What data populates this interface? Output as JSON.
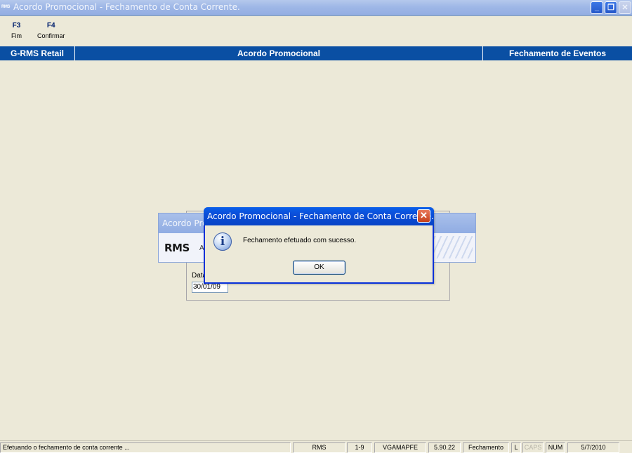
{
  "window": {
    "title": "Acordo Promocional - Fechamento de Conta Corrente.",
    "icon_label": "RMS"
  },
  "toolbar": {
    "keys": [
      {
        "key": "F3",
        "label": "Fim"
      },
      {
        "key": "F4",
        "label": "Confirmar"
      }
    ]
  },
  "header": {
    "left": "G-RMS Retail",
    "center": "Acordo Promocional",
    "right": "Fechamento de Eventos"
  },
  "form": {
    "date_label": "Data",
    "date_value": "30/01/09"
  },
  "background_window": {
    "title": "Acordo Pro",
    "logo_text": "RMS",
    "logo_tail": "A"
  },
  "dialog": {
    "title": "Acordo Promocional - Fechamento de Conta Corrente.",
    "message": "Fechamento efetuado com sucesso.",
    "ok_label": "OK",
    "close_glyph": "✕",
    "icon": "info-icon"
  },
  "statusbar": {
    "message": "Efetuando o fechamento de conta corrente ...",
    "system": "RMS",
    "range": "1-9",
    "program": "VGAMAPFE",
    "version": "5.90.22",
    "mode": "Fechamento",
    "flag": "L",
    "caps": "CAPS",
    "num": "NUM",
    "date": "5/7/2010"
  },
  "colors": {
    "titlebar_active": "#0A4FA3",
    "dialog_title": "#0B4ED8",
    "background": "#ECE9D8"
  }
}
